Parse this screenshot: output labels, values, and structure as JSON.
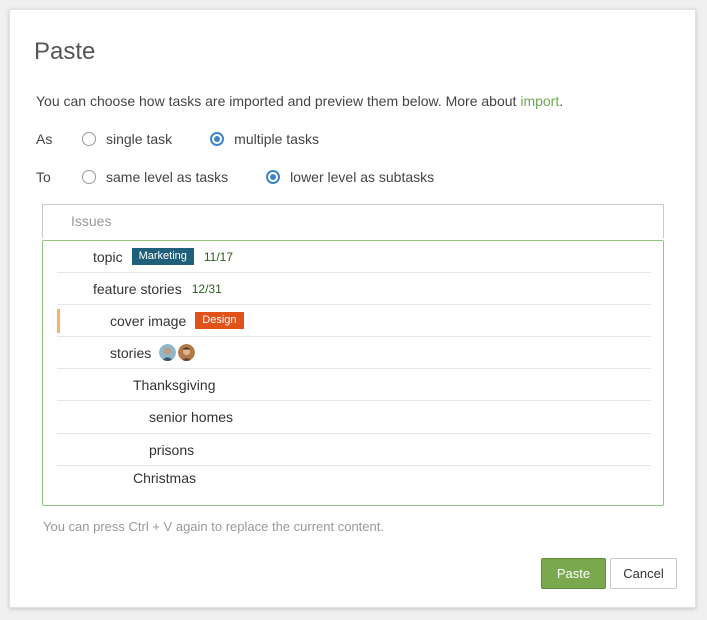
{
  "dialog": {
    "title": "Paste",
    "intro_text": "You can choose how tasks are imported and preview them below. More about ",
    "intro_link": "import",
    "intro_suffix": "."
  },
  "options": {
    "as": {
      "label": "As",
      "choices": [
        {
          "label": "single task",
          "selected": false
        },
        {
          "label": "multiple tasks",
          "selected": true
        }
      ]
    },
    "to": {
      "label": "To",
      "choices": [
        {
          "label": "same level as tasks",
          "selected": false
        },
        {
          "label": "lower level as subtasks",
          "selected": true
        }
      ]
    }
  },
  "preview": {
    "parent_label": "Issues",
    "rows": [
      {
        "text": "topic",
        "tag": "Marketing",
        "tag_color": "#1f5f7a",
        "count": "11/17"
      },
      {
        "text": "feature stories",
        "count": "12/31"
      },
      {
        "text": "cover image",
        "tag": "Design",
        "tag_color": "#e0521a",
        "marker_color": "#f6b26b"
      },
      {
        "text": "stories",
        "avatars": [
          "avatar-user-1",
          "avatar-user-2"
        ]
      },
      {
        "text": "Thanksgiving"
      },
      {
        "text": "senior homes"
      },
      {
        "text": "prisons"
      },
      {
        "text": "Christmas"
      }
    ]
  },
  "footnote": "You can press Ctrl + V again to replace the current content.",
  "buttons": {
    "paste": "Paste",
    "cancel": "Cancel"
  },
  "colors": {
    "accent_green": "#7aa84f",
    "radio_blue": "#3d85c6",
    "preview_border": "#93c47d"
  }
}
